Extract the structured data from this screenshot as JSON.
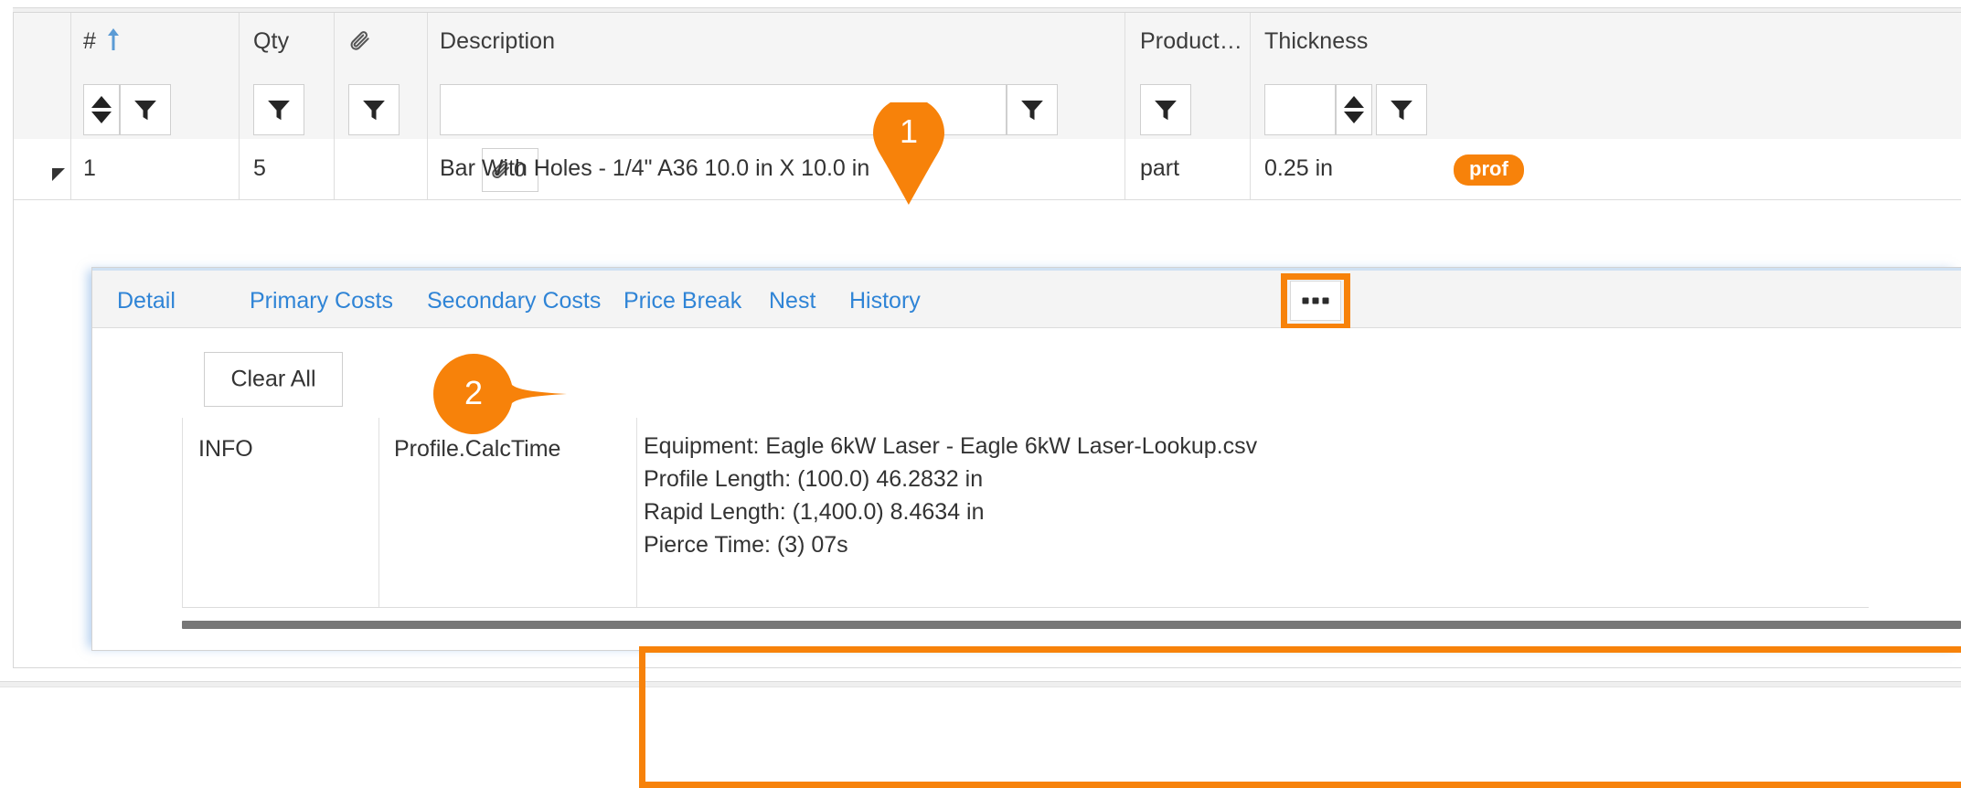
{
  "grid": {
    "columns": [
      {
        "key": "expander",
        "label": ""
      },
      {
        "key": "num",
        "label": "#"
      },
      {
        "key": "qty",
        "label": "Qty"
      },
      {
        "key": "attach",
        "label": "attachment-icon"
      },
      {
        "key": "desc",
        "label": "Description"
      },
      {
        "key": "producttype",
        "label": "Product…"
      },
      {
        "key": "thickness",
        "label": "Thickness"
      }
    ],
    "sort": {
      "column": "#",
      "direction": "ascending",
      "glyph": "↑"
    },
    "filter_row": {
      "description_value": "",
      "thickness_value": "",
      "funnel_icon": "filter-funnel-icon",
      "spinner_icon": "number-spinner-icon"
    },
    "rows": [
      {
        "num": "1",
        "qty": "5",
        "attachment_count": "0",
        "description": "Bar With Holes - 1/4\" A36 10.0 in X 10.0 in",
        "badge": "prof",
        "product_type": "part",
        "thickness": "0.25 in"
      }
    ]
  },
  "detail_panel": {
    "tabs": [
      {
        "label": "Detail"
      },
      {
        "label": "Primary Costs"
      },
      {
        "label": "Secondary Costs"
      },
      {
        "label": "Price Break"
      },
      {
        "label": "Nest"
      },
      {
        "label": "History"
      }
    ],
    "overflow_tab": {
      "name": "more-tabs",
      "glyph": "•••"
    },
    "clear_all_label": "Clear All",
    "message_table": {
      "severity": "INFO",
      "source": "Profile.CalcTime",
      "detail_lines": [
        "Equipment: Eagle 6kW Laser - Eagle 6kW Laser-Lookup.csv",
        "Profile Length:  (100.0) 46.2832 in",
        "Rapid Length: (1,400.0) 8.4634 in",
        "Pierce Time:  (3)  07s"
      ]
    }
  },
  "annotations": {
    "accent_color": "#f7820a",
    "markers": [
      {
        "number": "1",
        "shape": "pin-down",
        "target": "more-tabs-button"
      },
      {
        "number": "2",
        "shape": "bubble-right",
        "target": "detail-message-text"
      }
    ]
  },
  "colors": {
    "accent_orange": "#f7820a",
    "link_blue": "#2f84d6",
    "header_bg": "#f5f5f5",
    "border_gray": "#d9d9d9",
    "text_dark": "#333333"
  }
}
